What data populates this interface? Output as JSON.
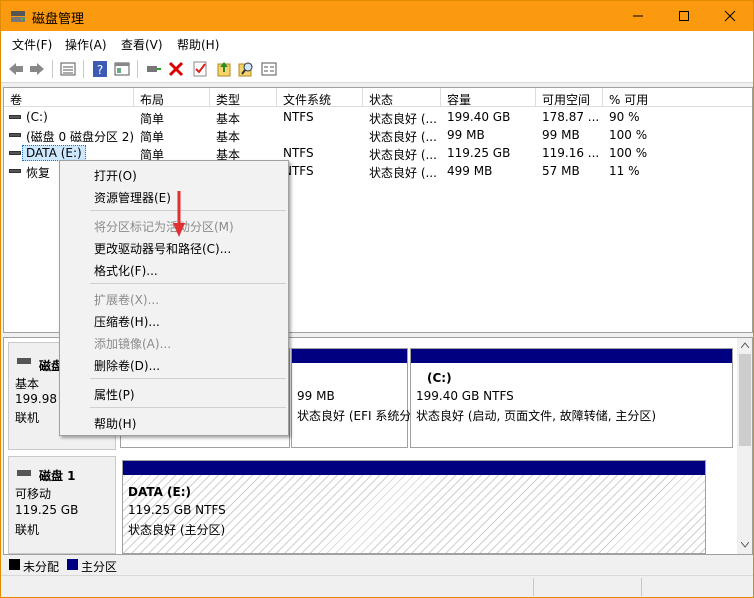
{
  "window": {
    "title": "磁盘管理"
  },
  "menubar": [
    "文件(F)",
    "操作(A)",
    "查看(V)",
    "帮助(H)"
  ],
  "colors": {
    "titlebar": "#fb9a0e",
    "partition_bar": "#000080",
    "selection": "#cde8ff",
    "arrow": "#e03030"
  },
  "columns": [
    "卷",
    "布局",
    "类型",
    "文件系统",
    "状态",
    "容量",
    "可用空间",
    "% 可用"
  ],
  "volumes": [
    {
      "name": "(C:)",
      "layout": "简单",
      "type": "基本",
      "fs": "NTFS",
      "status": "状态良好 (...",
      "capacity": "199.40 GB",
      "free": "178.87 ...",
      "pct": "90 %"
    },
    {
      "name": "(磁盘 0 磁盘分区 2)",
      "layout": "简单",
      "type": "基本",
      "fs": "",
      "status": "状态良好 (...",
      "capacity": "99 MB",
      "free": "99 MB",
      "pct": "100 %"
    },
    {
      "name": "DATA (E:)",
      "layout": "简单",
      "type": "基本",
      "fs": "NTFS",
      "status": "状态良好 (...",
      "capacity": "119.25 GB",
      "free": "119.16 ...",
      "pct": "100 %"
    },
    {
      "name": "恢复",
      "layout": "",
      "type": "",
      "fs": "NTFS",
      "status": "状态良好 (...",
      "capacity": "499 MB",
      "free": "57 MB",
      "pct": "11 %"
    }
  ],
  "disk0": {
    "label": "磁盘",
    "kind": "基本",
    "size": "199.98 G",
    "state": "联机"
  },
  "disk0_parts": {
    "efi": {
      "size": "99 MB",
      "status": "状态良好 (EFI 系统分"
    },
    "c": {
      "name": "(C:)",
      "size": "199.40 GB NTFS",
      "status": "状态良好 (启动, 页面文件, 故障转储, 主分区)"
    }
  },
  "disk1": {
    "label": "磁盘 1",
    "kind": "可移动",
    "size": "119.25 GB",
    "state": "联机"
  },
  "disk1_part": {
    "name": "DATA  (E:)",
    "size": "119.25 GB NTFS",
    "status": "状态良好 (主分区)"
  },
  "legend": {
    "unallocated": "未分配",
    "primary": "主分区"
  },
  "context_menu": {
    "open": "打开(O)",
    "explorer": "资源管理器(E)",
    "mark_active": "将分区标记为活动分区(M)",
    "change_letter": "更改驱动器号和路径(C)...",
    "format": "格式化(F)...",
    "extend": "扩展卷(X)...",
    "shrink": "压缩卷(H)...",
    "mirror": "添加镜像(A)...",
    "delete": "删除卷(D)...",
    "properties": "属性(P)",
    "help": "帮助(H)"
  },
  "icons": [
    "back-icon",
    "forward-icon",
    "list-view-icon",
    "help-icon",
    "console-icon",
    "connect-icon",
    "delete-icon",
    "check-icon",
    "up-icon",
    "search-icon",
    "properties-icon"
  ]
}
